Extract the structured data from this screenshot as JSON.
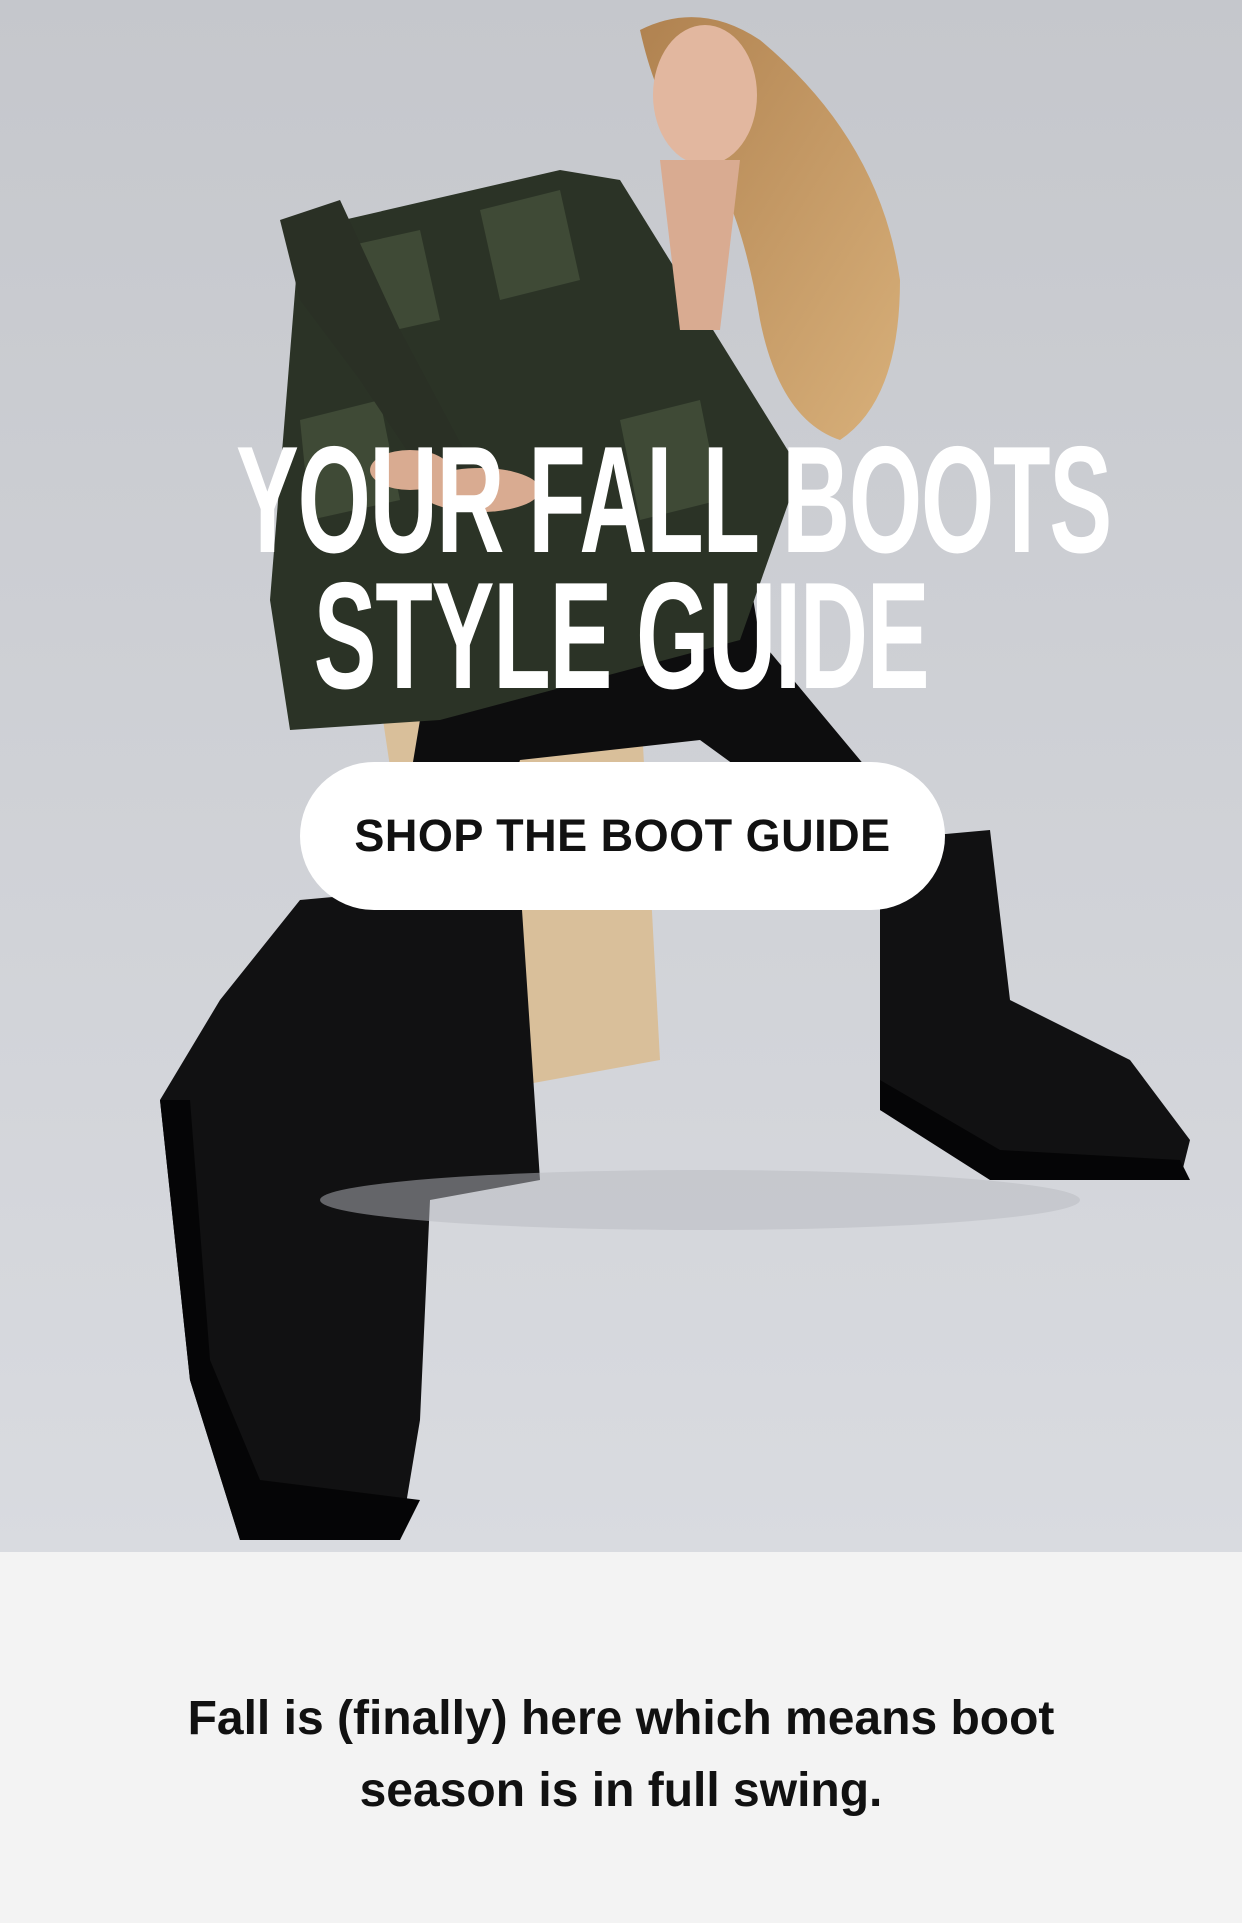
{
  "hero": {
    "headline_line1": "YOUR FALL BOOTS",
    "headline_line2": "STYLE GUIDE",
    "cta_label": "SHOP THE BOOT GUIDE",
    "image_subject": "model-in-plaid-shirt-and-black-lug-sole-boots"
  },
  "intro": {
    "text": "Fall is (finally) here which means boot season is in full swing."
  },
  "colors": {
    "hero_background": "#c9cbd0",
    "text_light": "#ffffff",
    "text_dark": "#111111",
    "page_background": "#f3f3f3",
    "cta_background": "#ffffff"
  }
}
